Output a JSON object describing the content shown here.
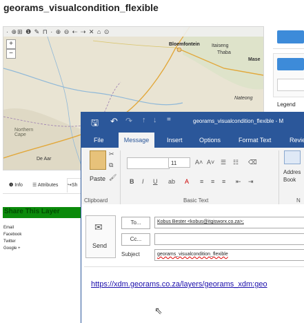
{
  "page": {
    "title": "georams_visualcondition_flexible"
  },
  "map": {
    "toolbar_icons": "· ⊕⊞ ❶ ✎ ⊓ · ⊕ ⊖ ⇠ ⇢ ✕ ⌂ ⊙",
    "zoom_in": "+",
    "zoom_out": "−",
    "places": {
      "bloemfontein": "Bloemfontein",
      "itaiseng": "Itaiseng",
      "thaba": "Thaba",
      "northern_cape": "Northern\nCape",
      "de_aar": "De Aar",
      "maseru": "Mase",
      "nateong": "Nateong"
    }
  },
  "side_panel": {
    "legend_label": "Legend"
  },
  "page_tabs": {
    "info": "Info",
    "attributes": "Attributes",
    "share": "Sh"
  },
  "share_panel": {
    "title": "Share This Layer",
    "links": [
      "Email",
      "Facebook",
      "Twitter",
      "Google +"
    ]
  },
  "outlook": {
    "window_title": "georams_visualcondition_flexible  -  M",
    "tabs": [
      "File",
      "Message",
      "Insert",
      "Options",
      "Format Text",
      "Revie"
    ],
    "ribbon": {
      "paste_label": "Paste",
      "font_size": "11",
      "address_book_label": "Addres\nBook",
      "groups": [
        "Clipboard",
        "Basic Text",
        "N"
      ]
    },
    "compose": {
      "send_label": "Send",
      "to_button": "To...",
      "cc_button": "Cc...",
      "to_value": "Kobus Bester <kobus@itgisworx.co.za>;",
      "subject_label": "Subject",
      "subject_value": "georams_visualcondition_flexible",
      "body_link": "https://xdm.georams.co.za/layers/georams_xdm:geo"
    }
  },
  "colors": {
    "outlook_blue": "#2b579a",
    "share_green": "#0a8a0a",
    "panel_blue_button": "#3d8bd9"
  }
}
